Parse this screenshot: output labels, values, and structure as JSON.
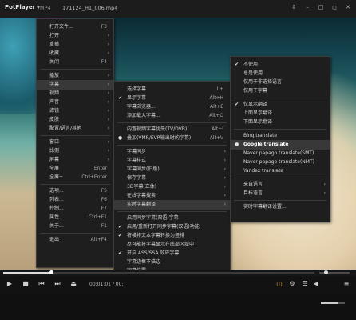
{
  "titlebar": {
    "app": "PotPlayer",
    "format": "MP4",
    "filename": "171124_H1_006.mp4"
  },
  "controls": {
    "time": "00:01:01 / 00:"
  },
  "main_menu": [
    {
      "label": "打开文件...",
      "shortcut": "F3"
    },
    {
      "label": "打开",
      "arrow": true
    },
    {
      "label": "重播",
      "arrow": true
    },
    {
      "label": "收藏",
      "arrow": true
    },
    {
      "label": "关闭",
      "shortcut": "F4"
    },
    {
      "sep": true
    },
    {
      "label": "播放",
      "arrow": true
    },
    {
      "label": "字幕",
      "arrow": true,
      "highlight": true
    },
    {
      "label": "视频",
      "arrow": true
    },
    {
      "label": "声音",
      "arrow": true
    },
    {
      "label": "滤镜",
      "arrow": true
    },
    {
      "label": "皮肤",
      "arrow": true
    },
    {
      "label": "配置/语言/其他",
      "arrow": true
    },
    {
      "sep": true
    },
    {
      "label": "窗口",
      "arrow": true
    },
    {
      "label": "比例",
      "arrow": true
    },
    {
      "label": "屏幕",
      "arrow": true
    },
    {
      "label": "全屏",
      "shortcut": "Enter"
    },
    {
      "label": "全屏+",
      "shortcut": "Ctrl+Enter"
    },
    {
      "sep": true
    },
    {
      "label": "选项...",
      "shortcut": "F5"
    },
    {
      "label": "列表...",
      "shortcut": "F6"
    },
    {
      "label": "控制...",
      "shortcut": "F7"
    },
    {
      "label": "属性...",
      "shortcut": "Ctrl+F1"
    },
    {
      "label": "关于...",
      "shortcut": "F1"
    },
    {
      "sep": true
    },
    {
      "label": "退出",
      "shortcut": "Alt+F4"
    }
  ],
  "subtitle_menu": [
    {
      "label": "选择字幕",
      "shortcut": "L+"
    },
    {
      "label": "显示字幕",
      "shortcut": "Alt+H",
      "check": true
    },
    {
      "label": "字幕浏览器...",
      "shortcut": "Alt+E"
    },
    {
      "label": "添加载入字幕...",
      "shortcut": "Alt+O"
    },
    {
      "sep": true
    },
    {
      "label": "内置视频字幕优先(TV/DVB)",
      "shortcut": "Alt+I"
    },
    {
      "label": "叠加(VMR/EVR输出时的字幕)",
      "shortcut": "Alt+V",
      "dot": true
    },
    {
      "sep": true
    },
    {
      "label": "字幕同步",
      "arrow": true
    },
    {
      "label": "字幕样式",
      "arrow": true
    },
    {
      "label": "字幕同步(旧版)",
      "arrow": true
    },
    {
      "label": "保存字幕",
      "arrow": true
    },
    {
      "label": "3D字幕(立体)",
      "arrow": true
    },
    {
      "label": "在线字幕搜索",
      "arrow": true
    },
    {
      "label": "实时字幕翻译",
      "arrow": true,
      "highlight": true
    },
    {
      "sep": true
    },
    {
      "label": "启用同步字幕(双语)字幕"
    },
    {
      "label": "启用/重新打开同步字幕(双语)功能",
      "check": true
    },
    {
      "label": "将横排文本字幕转换为竖排",
      "check": true
    },
    {
      "label": "尽可能将字幕显示在底部区域中"
    },
    {
      "label": "开启 ASS/SSA 效应字幕",
      "check": true
    },
    {
      "label": "字幕边框不描边"
    },
    {
      "label": "字幕位置"
    },
    {
      "label": "字幕输出 VMR/EVR 字幕"
    },
    {
      "sep": true
    },
    {
      "label": "字幕设置..."
    }
  ],
  "translate_menu": [
    {
      "label": "不使用",
      "check": true
    },
    {
      "label": "总是使用"
    },
    {
      "label": "仅用于非选择语言"
    },
    {
      "label": "仅用于字幕"
    },
    {
      "sep": true
    },
    {
      "label": "仅显示翻译",
      "check": true
    },
    {
      "label": "上面显示翻译"
    },
    {
      "label": "下面显示翻译"
    },
    {
      "sep": true
    },
    {
      "label": "Bing translate"
    },
    {
      "label": "Google translate",
      "dot": true,
      "highlight": true
    },
    {
      "label": "Naver papago translate(SMT)"
    },
    {
      "label": "Naver papago translate(NMT)"
    },
    {
      "label": "Yandex translate"
    },
    {
      "sep": true
    },
    {
      "label": "来自语言",
      "arrow": true
    },
    {
      "label": "目标语言",
      "arrow": true
    },
    {
      "sep": true
    },
    {
      "label": "实时字幕翻译设置..."
    }
  ]
}
